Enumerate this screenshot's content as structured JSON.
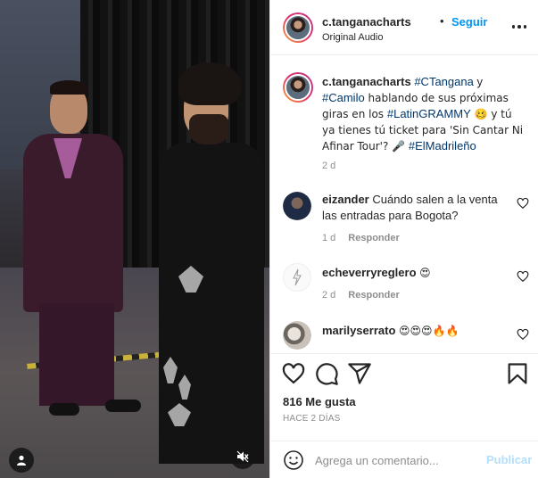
{
  "header": {
    "username": "c.tanganacharts",
    "separator": "•",
    "follow_label": "Seguir",
    "audio_label": "Original Audio"
  },
  "caption": {
    "username": "c.tanganacharts",
    "tag1": "#CTangana",
    "part1": " y ",
    "tag2": "#Camilo",
    "part2": " hablando de sus próximas giras en los ",
    "tag3": "#LatinGRAMMY",
    "part3": " 🥴 y tú ya tienes tú ticket para 'Sin Cantar Ni Afinar Tour'? 🎤 ",
    "tag4": "#ElMadrileño",
    "time": "2 d"
  },
  "comments": [
    {
      "username": "eizander",
      "text": "Cuándo salen a la venta las entradas para Bogota?",
      "time": "1 d",
      "reply_label": "Responder"
    },
    {
      "username": "echeverryreglero",
      "text": "😍",
      "time": "2 d",
      "reply_label": "Responder"
    },
    {
      "username": "marilyserrato",
      "text": "😍😍😍🔥🔥"
    }
  ],
  "actions": {
    "likes": "816 Me gusta",
    "posted_ago": "HACE 2 DÍAS"
  },
  "add_comment": {
    "placeholder": "Agrega un comentario...",
    "publish_label": "Publicar"
  },
  "icons": [
    "user-tag-icon",
    "mute-icon",
    "more-options-icon",
    "heart-icon",
    "comment-icon",
    "share-icon",
    "save-icon",
    "emoji-icon"
  ],
  "colors": {
    "accent": "#0095f6",
    "hashtag": "#00376b",
    "muted": "#8e8e8e",
    "publish_disabled": "#b2dffc"
  }
}
